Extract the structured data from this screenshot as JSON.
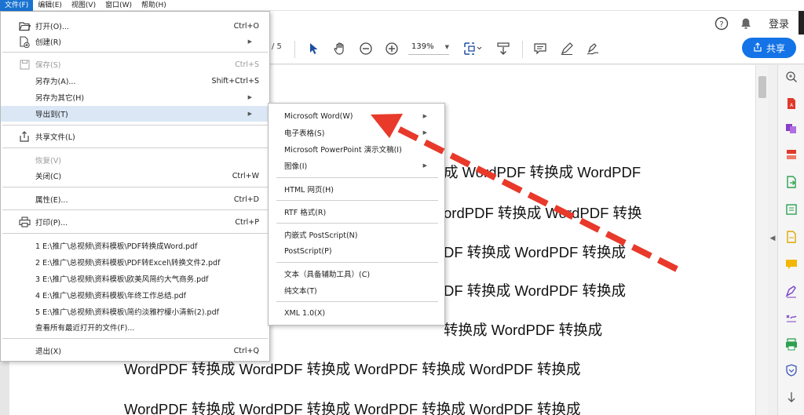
{
  "menubar": [
    "文件(F)",
    "编辑(E)",
    "视图(V)",
    "窗口(W)",
    "帮助(H)"
  ],
  "toolbar": {
    "page_of": "/ 5",
    "zoom": "139%",
    "login": "登录",
    "share_label": "共享"
  },
  "file_menu": {
    "open": {
      "label": "打开(O)...",
      "shortcut": "Ctrl+O"
    },
    "create": {
      "label": "创建(R)"
    },
    "save": {
      "label": "保存(S)",
      "shortcut": "Ctrl+S"
    },
    "save_as": {
      "label": "另存为(A)...",
      "shortcut": "Shift+Ctrl+S"
    },
    "save_as_other": {
      "label": "另存为其它(H)"
    },
    "export_to": {
      "label": "导出到(T)"
    },
    "share_file": {
      "label": "共享文件(L)"
    },
    "revert": {
      "label": "恢复(V)"
    },
    "close": {
      "label": "关闭(C)",
      "shortcut": "Ctrl+W"
    },
    "properties": {
      "label": "属性(E)...",
      "shortcut": "Ctrl+D"
    },
    "print": {
      "label": "打印(P)...",
      "shortcut": "Ctrl+P"
    },
    "recent": [
      "1 E:\\推广\\总视频\\资料模板\\PDF转换成Word.pdf",
      "2 E:\\推广\\总视频\\资料模板\\PDF转Excel\\转换文件2.pdf",
      "3 E:\\推广\\总视频\\资料模板\\欧美风简约大气商务.pdf",
      "4 E:\\推广\\总视频\\资料模板\\年终工作总结.pdf",
      "5 E:\\推广\\总视频\\资料模板\\简约淡雅柠檬小清新(2).pdf"
    ],
    "view_all_recent": "查看所有最近打开的文件(F)...",
    "exit": {
      "label": "退出(X)",
      "shortcut": "Ctrl+Q"
    }
  },
  "export_menu": {
    "word": "Microsoft Word(W)",
    "spreadsheet": "电子表格(S)",
    "powerpoint": "Microsoft PowerPoint 演示文稿(I)",
    "image": "图像(I)",
    "html": "HTML 网页(H)",
    "rtf": "RTF 格式(R)",
    "eps": "内嵌式 PostScript(N)",
    "postscript": "PostScript(P)",
    "text_accessible": "文本（具备辅助工具）(C)",
    "text_plain": "纯文本(T)",
    "xml": "XML 1.0(X)"
  },
  "document_lines": [
    "成 WordPDF 转换成 WordPDF",
    "ordPDF 转换成 WordPDF 转换",
    "DF 转换成 WordPDF 转换成",
    "DF 转换成 WordPDF 转换成",
    "转换成 WordPDF 转换成",
    "WordPDF 转换成 WordPDF 转换成 WordPDF 转换成 WordPDF 转换成",
    "WordPDF 转换成 WordPDF 转换成 WordPDF 转换成 WordPDF 转换成"
  ],
  "colors": {
    "accent": "#1473e6",
    "menu_highlight": "#dbe7f5",
    "arrow": "#e8392a"
  }
}
